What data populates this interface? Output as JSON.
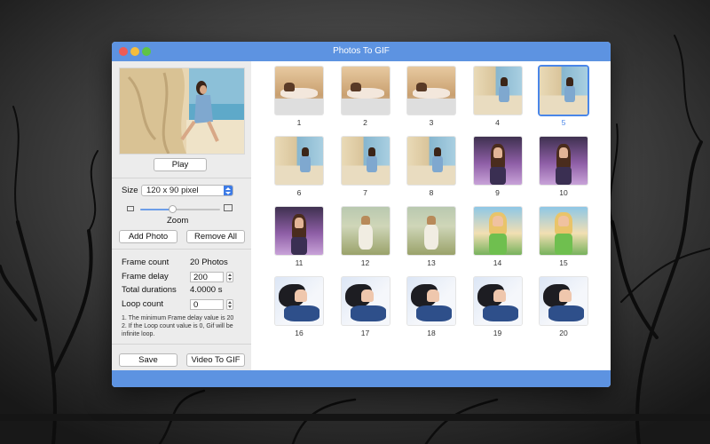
{
  "window": {
    "title": "Photos To GIF"
  },
  "left": {
    "play_label": "Play",
    "size_label": "Size",
    "size_value": "120 x 90 pixel",
    "zoom_label": "Zoom",
    "zoom_level": 0.4,
    "add_photo_label": "Add Photo",
    "remove_all_label": "Remove All",
    "frame_count_label": "Frame count",
    "frame_count_value": "20 Photos",
    "frame_delay_label": "Frame delay",
    "frame_delay_value": "200",
    "total_durations_label": "Total durations",
    "total_durations_value": "4.0000 s",
    "loop_count_label": "Loop count",
    "loop_count_value": "0",
    "note_1": "1. The minimum Frame delay value is 20",
    "note_2": "2. If the Loop count value is 0, Gif will be infinite loop.",
    "save_label": "Save",
    "video_to_gif_label": "Video To GIF"
  },
  "thumbnails": [
    {
      "n": "1",
      "style": "lying"
    },
    {
      "n": "2",
      "style": "lying"
    },
    {
      "n": "3",
      "style": "lying"
    },
    {
      "n": "4",
      "style": "rocks"
    },
    {
      "n": "5",
      "style": "rocks",
      "selected": true
    },
    {
      "n": "6",
      "style": "rocks"
    },
    {
      "n": "7",
      "style": "rocks"
    },
    {
      "n": "8",
      "style": "rocks"
    },
    {
      "n": "9",
      "style": "purple"
    },
    {
      "n": "10",
      "style": "purple"
    },
    {
      "n": "11",
      "style": "purple"
    },
    {
      "n": "12",
      "style": "field"
    },
    {
      "n": "13",
      "style": "field"
    },
    {
      "n": "14",
      "style": "rainbow"
    },
    {
      "n": "15",
      "style": "rainbow"
    },
    {
      "n": "16",
      "style": "hair"
    },
    {
      "n": "17",
      "style": "hair"
    },
    {
      "n": "18",
      "style": "hair"
    },
    {
      "n": "19",
      "style": "hair"
    },
    {
      "n": "20",
      "style": "hair"
    }
  ],
  "colors": {
    "accent": "#5d93e1",
    "selection": "#4a86e8"
  }
}
